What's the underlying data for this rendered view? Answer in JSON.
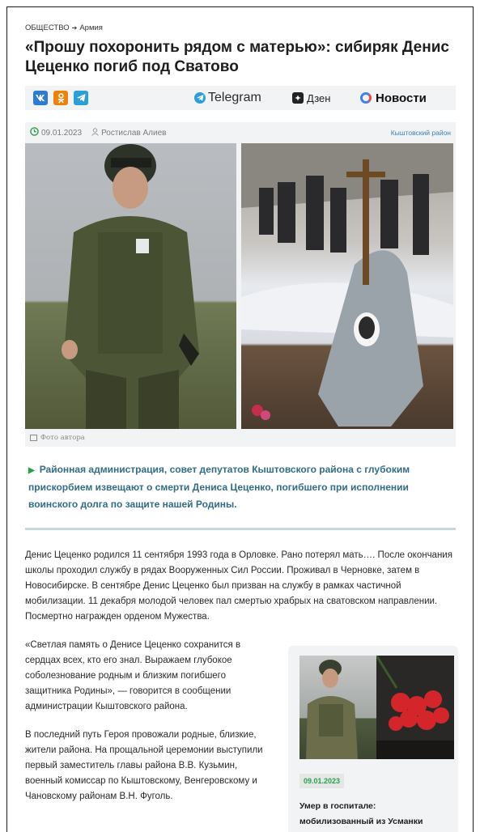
{
  "breadcrumb": {
    "section": "ОБЩЕСТВО",
    "subsection": "Армия"
  },
  "article": {
    "title": "«Прошу похоронить рядом с матерью»: сибиряк Денис Цеценко погиб под Сватово",
    "date": "09.01.2023",
    "author": "Ростислав Алиев",
    "region": "Кыштовский район",
    "photo_caption": "Фото автора",
    "lead": "Районная администрация, совет депутатов Кыштовского района с глубоким прискорбием извещают о смерти Дениса Цеценко, погибшего при исполнении воинского долга по защите нашей Родины.",
    "paragraphs": [
      "Денис Цеценко родился 11 сентября 1993 года в Орловке. Рано потерял мать…. После окончания школы проходил службу в рядах Вооруженных Сил России. Проживал в Черновке, затем в Новосибирске. В сентябре Денис Цеценко был призван на службу в рамках частичной мобилизации. 11 декабря молодой человек пал смертью храбрых на сватовском направлении. Посмертно награжден орденом Мужества.",
      "«Светлая память о Денисе Цеценко сохранится в сердцах всех, кто его знал. Выражаем глубокое соболезнование родным и близким погибшего защитника Родины», — говорится в сообщении администрации Кыштовского района.",
      "В последний путь Героя провожали родные, близкие, жители района. На прощальной церемонии выступили первый заместитель главы района В.В. Кузьмин, военный комиссар по Кыштовскому, Венгеровскому и Чановскому районам В.Н. Фуголь."
    ]
  },
  "share": {
    "vk": "vk",
    "ok": "ok",
    "tg": "tg"
  },
  "partners": {
    "telegram": "Telegram",
    "dzen": "Дзен",
    "news": "Новости"
  },
  "related": {
    "date": "09.01.2023",
    "title": "Умер в госпитале: мобилизованный из Усманки"
  },
  "colors": {
    "accent_green": "#2e9b4a",
    "lead_blue": "#326c88",
    "link_blue": "#3a7fbf"
  }
}
